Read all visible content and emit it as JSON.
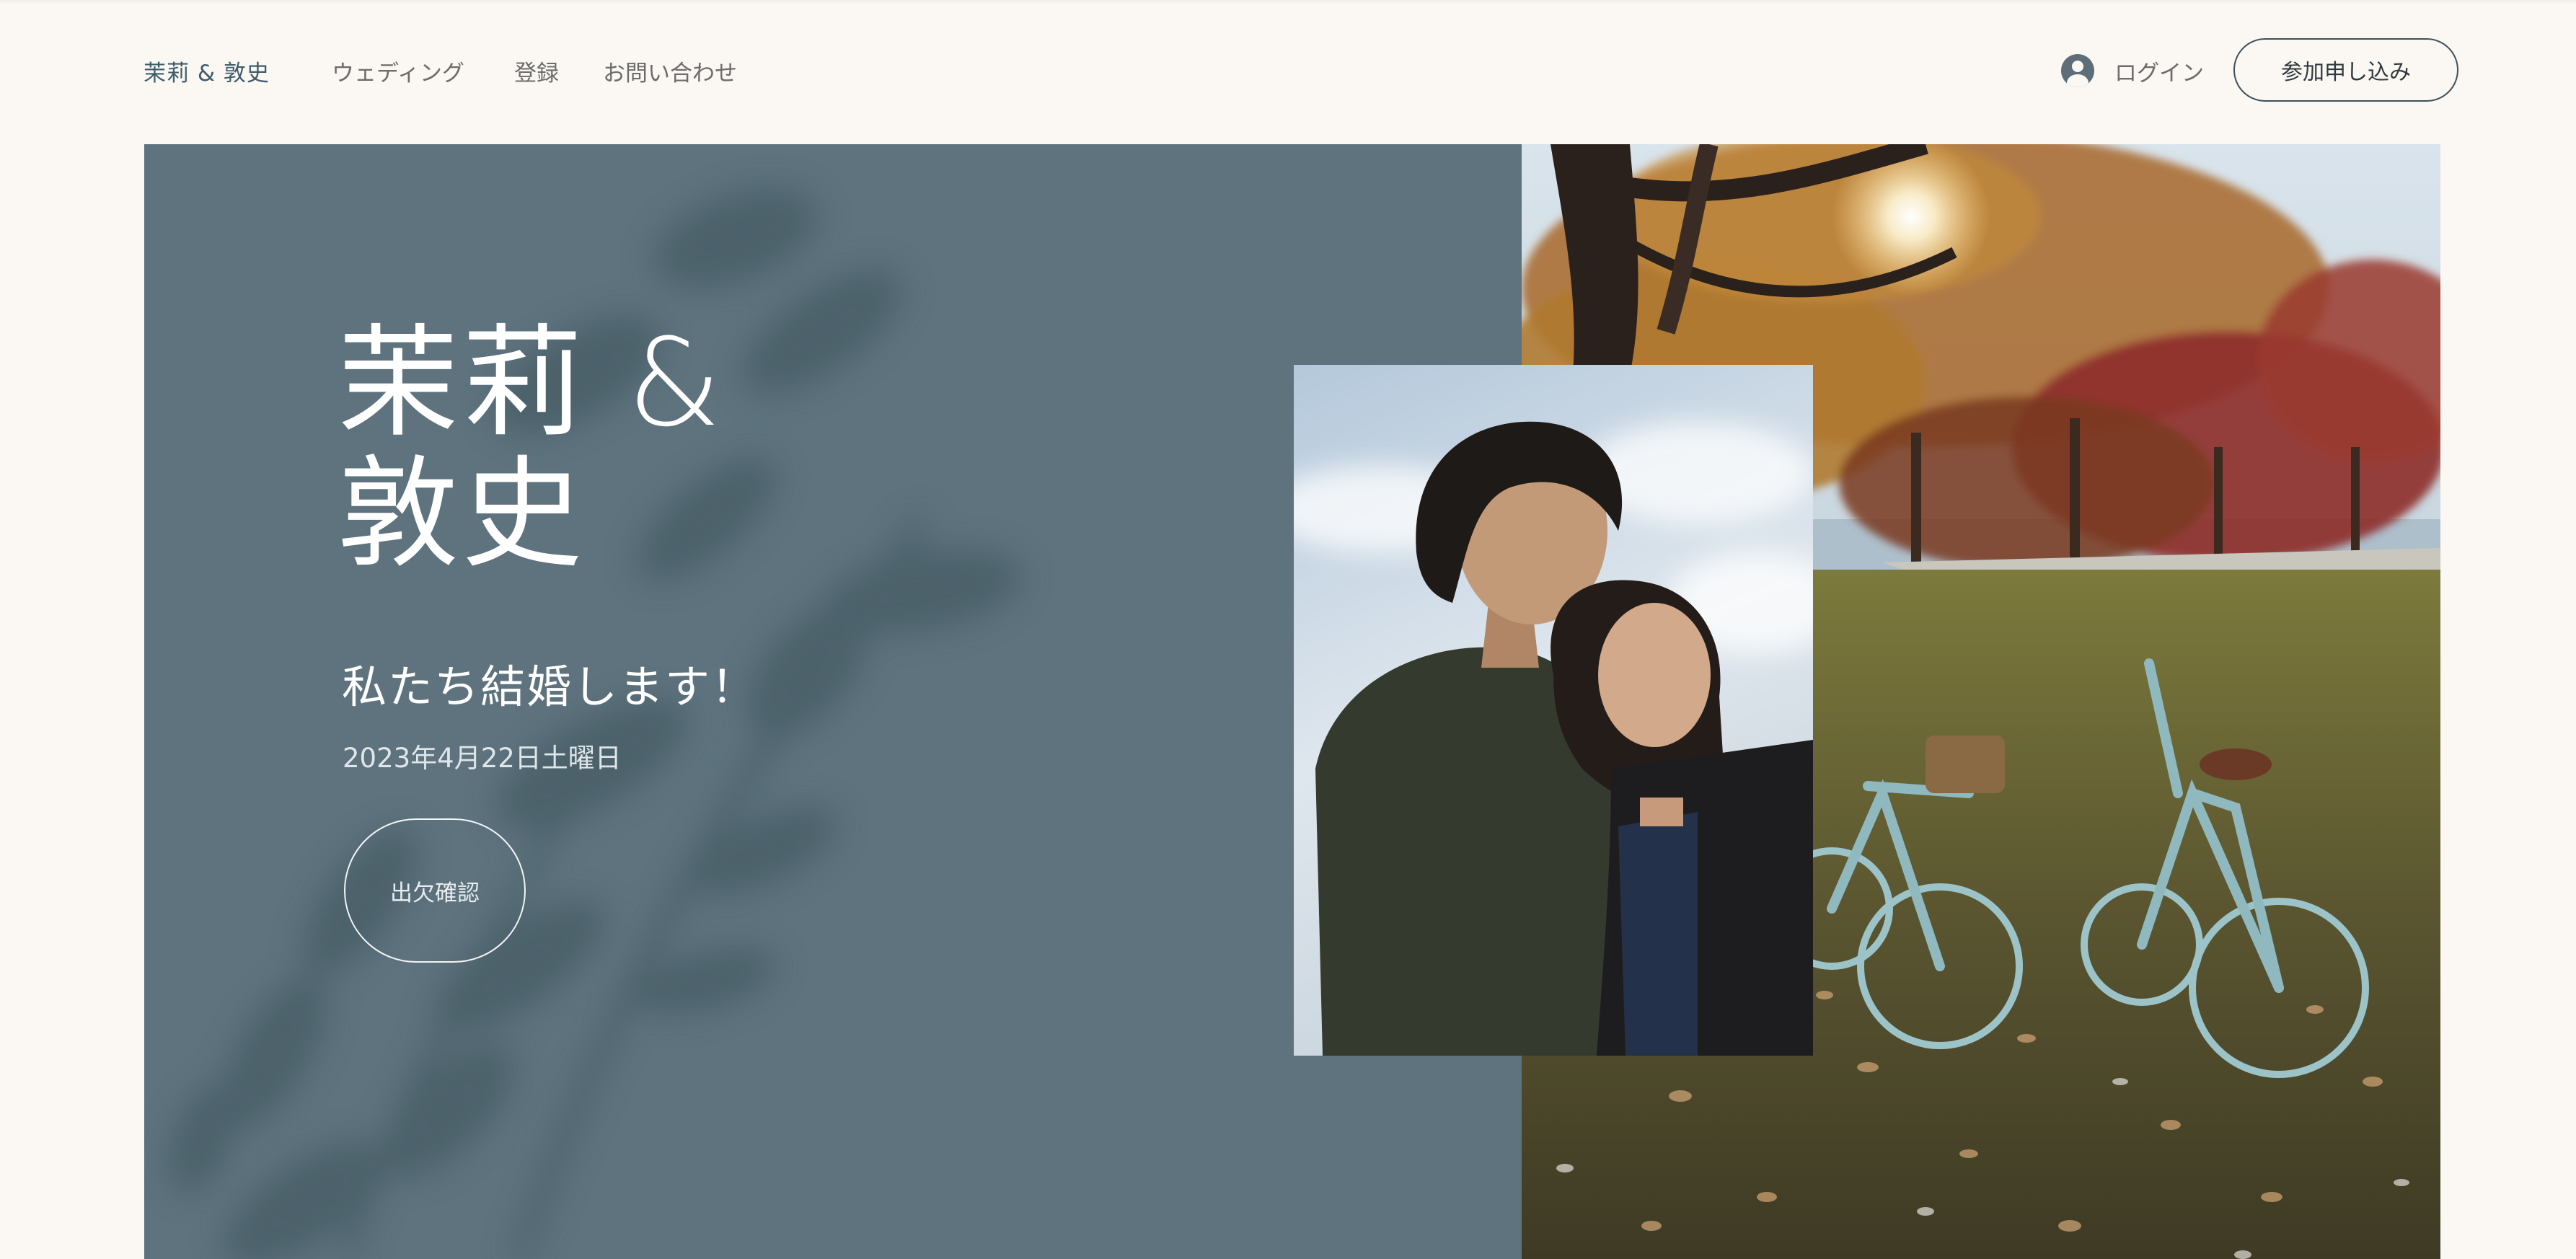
{
  "header": {
    "logo": "茉莉 & 敦史",
    "nav": [
      "ウェディング",
      "登録",
      "お問い合わせ"
    ],
    "login_label": "ログイン",
    "signup_label": "参加申し込み"
  },
  "hero": {
    "title_line1": "茉莉 &",
    "title_line2": "敦史",
    "subtitle": "私たち結婚します！",
    "date": "2023年4月22日土曜日",
    "rsvp_label": "出欠確認"
  },
  "icons": {
    "login": "user-avatar-icon"
  },
  "colors": {
    "page_bg": "#fbf7f2",
    "hero_panel": "#5e737e",
    "brand_text": "#3d5d6c",
    "nav_text": "#6c6c6c",
    "button_border": "#3f4f59"
  }
}
